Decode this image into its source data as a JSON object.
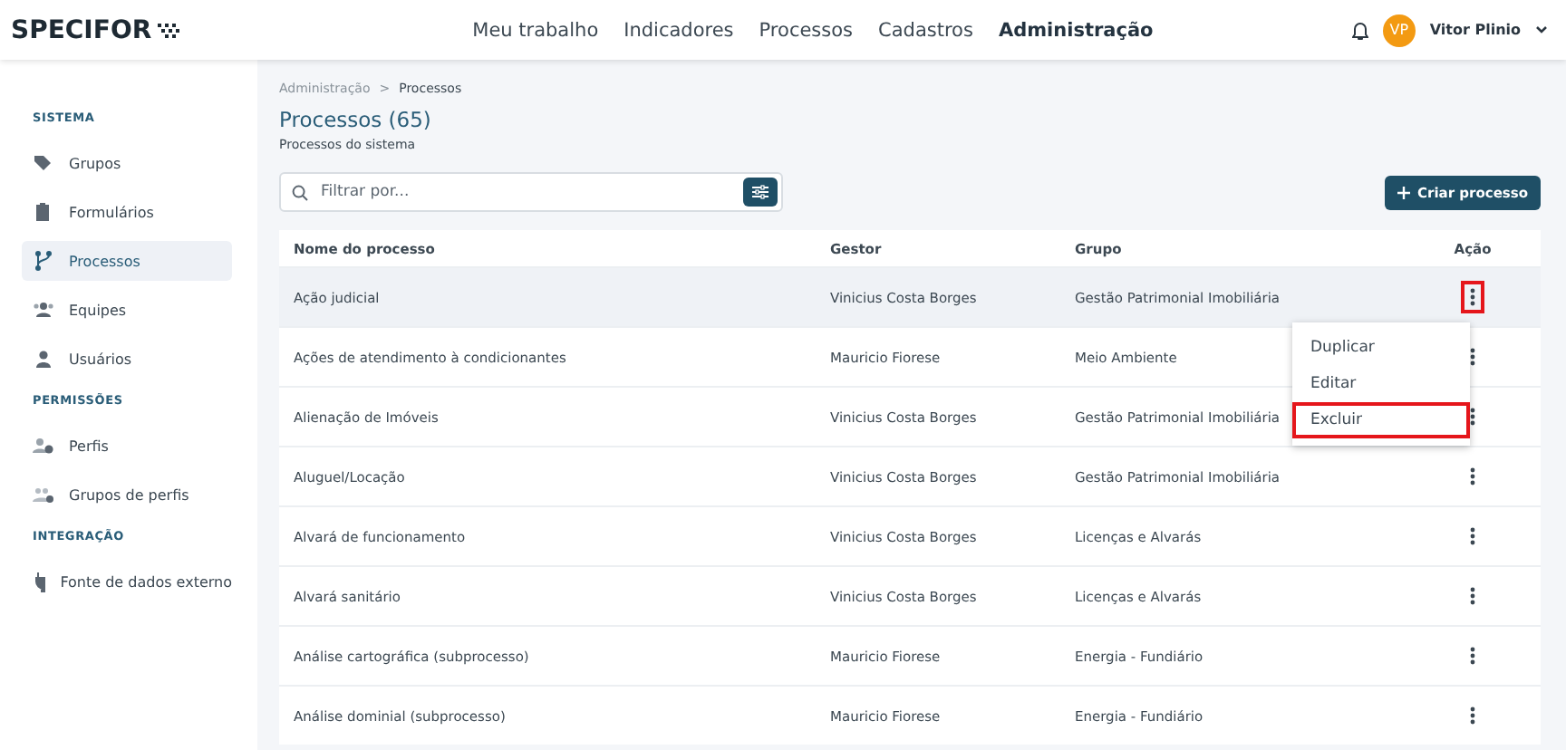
{
  "header": {
    "logo": "SPECIFOR",
    "nav": [
      {
        "label": "Meu trabalho",
        "selected": false
      },
      {
        "label": "Indicadores",
        "selected": false
      },
      {
        "label": "Processos",
        "selected": false
      },
      {
        "label": "Cadastros",
        "selected": false
      },
      {
        "label": "Administração",
        "selected": true
      }
    ],
    "user": {
      "initials": "VP",
      "name": "Vitor Plinio"
    }
  },
  "sidebar": {
    "sections": [
      {
        "title": "SISTEMA",
        "items": [
          {
            "label": "Grupos",
            "kind": "tag",
            "selected": false
          },
          {
            "label": "Formulários",
            "kind": "clipboard",
            "selected": false
          },
          {
            "label": "Processos",
            "kind": "branch",
            "selected": true
          },
          {
            "label": "Equipes",
            "kind": "team",
            "selected": false
          },
          {
            "label": "Usuários",
            "kind": "user",
            "selected": false
          }
        ]
      },
      {
        "title": "PERMISSÕES",
        "items": [
          {
            "label": "Perfis",
            "kind": "usergear",
            "selected": false
          },
          {
            "label": "Grupos de perfis",
            "kind": "teamgear",
            "selected": false
          }
        ]
      },
      {
        "title": "INTEGRAÇÃO",
        "items": [
          {
            "label": "Fonte de dados externo",
            "kind": "plug",
            "selected": false
          }
        ]
      }
    ]
  },
  "breadcrumb": [
    "Administração",
    ">",
    "Processos"
  ],
  "title": "Processos (65)",
  "subtitle": "Processos do sistema",
  "search": {
    "placeholder": "Filtrar por..."
  },
  "create_button": "Criar processo",
  "table": {
    "columns": [
      "Nome do processo",
      "Gestor",
      "Grupo",
      "Ação"
    ],
    "rows": [
      {
        "cells": [
          "Ação judicial",
          "Vinicius Costa Borges",
          "Gestão Patrimonial Imobiliária"
        ],
        "selected": true,
        "action_highlighted": true
      },
      {
        "cells": [
          "Ações de atendimento à condicionantes",
          "Mauricio Fiorese",
          "Meio Ambiente"
        ],
        "selected": false,
        "action_highlighted": false
      },
      {
        "cells": [
          "Alienação de Imóveis",
          "Vinicius Costa Borges",
          "Gestão Patrimonial Imobiliária"
        ],
        "selected": false,
        "action_highlighted": false
      },
      {
        "cells": [
          "Aluguel/Locação",
          "Vinicius Costa Borges",
          "Gestão Patrimonial Imobiliária"
        ],
        "selected": false,
        "action_highlighted": false
      },
      {
        "cells": [
          "Alvará de funcionamento",
          "Vinicius Costa Borges",
          "Licenças e Alvarás"
        ],
        "selected": false,
        "action_highlighted": false
      },
      {
        "cells": [
          "Alvará sanitário",
          "Vinicius Costa Borges",
          "Licenças e Alvarás"
        ],
        "selected": false,
        "action_highlighted": false
      },
      {
        "cells": [
          "Análise cartográfica (subprocesso)",
          "Mauricio Fiorese",
          "Energia - Fundiário"
        ],
        "selected": false,
        "action_highlighted": false
      },
      {
        "cells": [
          "Análise dominial (subprocesso)",
          "Mauricio Fiorese",
          "Energia - Fundiário"
        ],
        "selected": false,
        "action_highlighted": false
      }
    ]
  },
  "action_menu": [
    {
      "label": "Duplicar",
      "highlighted": false
    },
    {
      "label": "Editar",
      "highlighted": false
    },
    {
      "label": "Excluir",
      "highlighted": true
    }
  ]
}
